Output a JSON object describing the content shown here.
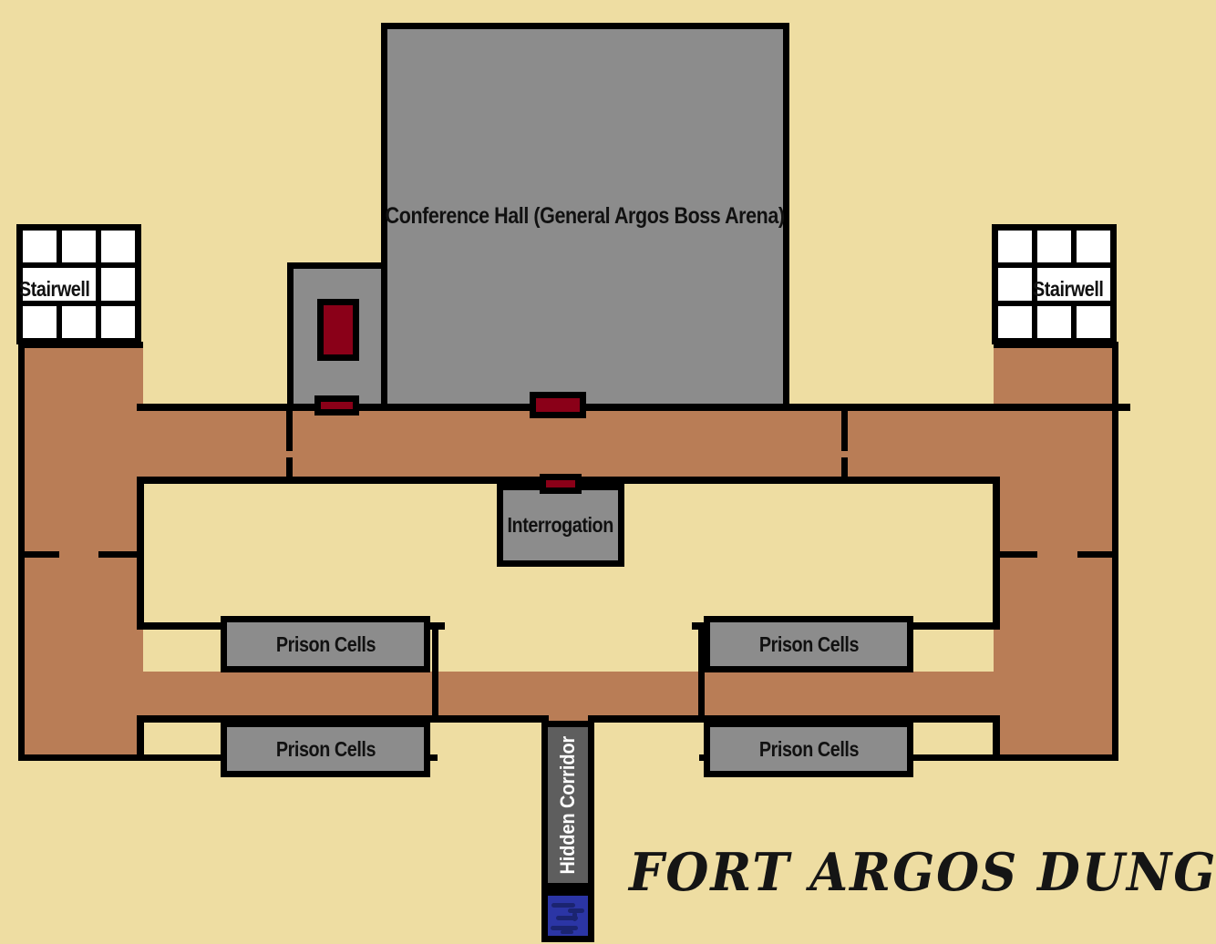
{
  "map": {
    "title": "FORT ARGOS DUNGEONS",
    "background_color": "#eedda2",
    "corridor_color": "#b97d56",
    "room_color": "#8c8c8c",
    "hidden_room_color": "#5e5e5e",
    "water_room_color": "#2b35a5",
    "door_color": "#8a0018",
    "wall_color": "#000000",
    "stair_cell_color": "#ffffff"
  },
  "rooms": {
    "conference_hall": {
      "label": "Conference Hall (General Argos Boss Arena)",
      "type": "boss-arena"
    },
    "anteroom": {
      "label": "",
      "type": "antechamber"
    },
    "interrogation": {
      "label": "Interrogation",
      "type": "room"
    },
    "hidden_corridor": {
      "label": "Hidden Corridor",
      "type": "secret-passage"
    },
    "secret_chamber": {
      "label": "",
      "type": "flooded-chamber"
    }
  },
  "stairwells": [
    {
      "label": "Stairwell",
      "position": "left"
    },
    {
      "label": "Stairwell",
      "position": "right"
    }
  ],
  "prison_cells": [
    {
      "label": "Prison Cells",
      "position": "upper-left"
    },
    {
      "label": "Prison Cells",
      "position": "upper-right"
    },
    {
      "label": "Prison Cells",
      "position": "lower-left"
    },
    {
      "label": "Prison Cells",
      "position": "lower-right"
    }
  ],
  "doors": [
    {
      "name": "anteroom-west-door",
      "orientation": "vertical"
    },
    {
      "name": "anteroom-south-door",
      "orientation": "horizontal"
    },
    {
      "name": "conference-hall-south-door",
      "orientation": "horizontal"
    },
    {
      "name": "interrogation-north-door",
      "orientation": "horizontal"
    }
  ]
}
